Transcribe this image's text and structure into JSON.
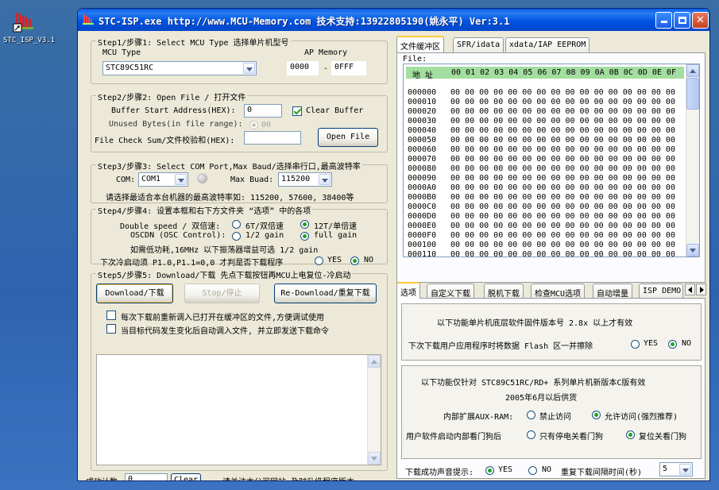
{
  "desktop": {
    "icon_label": "STC_ISP_V3.1"
  },
  "window": {
    "title": "STC-ISP.exe http://www.MCU-Memory.com 技术支持:13922805190(姚永平) Ver:3.1"
  },
  "step1": {
    "legend": "Step1/步骤1: Select MCU Type  选择单片机型号",
    "mcu_type_label": "MCU Type",
    "mcu_type_value": "STC89C51RC",
    "ap_memory_label": "AP Memory",
    "ap_start": "0000",
    "ap_dash": "-",
    "ap_end": "0FFF"
  },
  "step2": {
    "legend": "Step2/步骤2: Open File / 打开文件",
    "buffer_label": "Buffer Start Address(HEX):",
    "buffer_value": "0",
    "clear_buffer_label": "Clear Buffer",
    "unused_label": "Unused Bytes(in file range):",
    "unused_option": "00",
    "checksum_label": "File Check Sum/文件校验和(HEX):",
    "checksum_value": "",
    "open_file_label": "Open File"
  },
  "step3": {
    "legend": "Step3/步骤3: Select COM Port,Max Baud/选择串行口,最高波特率",
    "com_label": "COM:",
    "com_value": "COM1",
    "max_baud_label": "Max Buad:",
    "max_baud_value": "115200",
    "hint": "请选择最适合本台机器的最高波特率如: 115200, 57600, 38400等"
  },
  "step4": {
    "legend": "Step4/步骤4: 设置本框和右下方文件夹 “选项” 中的各项",
    "double_speed_label": "Double speed / 双倍速:",
    "opt_6t": "6T/双倍速",
    "opt_12t": "12T/单倍速",
    "oscdn_label": "OSCDN (OSC Control):",
    "opt_half_gain": "1/2 gain",
    "opt_full_gain": "full gain",
    "gain_hint": "如需低功耗,16MHz 以下振荡器增益可选 1/2 gain",
    "p10_label": "下次冷启动须 P1.0,P1.1=0,0 才判是否下载程序",
    "opt_yes": "YES",
    "opt_no": "NO"
  },
  "step5": {
    "legend": "Step5/步骤5: Download/下载  先点下载按钮再MCU上电复位-冷启动",
    "download_label": "Download/下载",
    "stop_label": "Stop/停止",
    "redownload_label": "Re-Download/重复下载",
    "reload_label": "每次下载前重新调入已打开在缓冲区的文件,方便调试使用",
    "auto_label": "当目标代码发生变化后自动调入文件, 并立即发送下载命令"
  },
  "bottom": {
    "success_count_label": "成功计数",
    "success_count_value": "0",
    "clear_label": "Clear",
    "notice": "请关注本公司网站,及时升级程序版本"
  },
  "buffer_tabs": [
    "文件缓冲区",
    "SFR/idata",
    "xdata/IAP EEPROM"
  ],
  "hex": {
    "file_label": "File:",
    "addr_header": "地 址",
    "columns": "00 01 02 03 04 05 06 07 08 09 0A 0B 0C 0D 0E 0F",
    "addresses": [
      "000000",
      "000010",
      "000020",
      "000030",
      "000040",
      "000050",
      "000060",
      "000070",
      "000080",
      "000090",
      "0000A0",
      "0000B0",
      "0000C0",
      "0000D0",
      "0000E0",
      "0000F0",
      "000100",
      "000110"
    ],
    "row_bytes": "00 00 00 00 00 00 00 00 00 00 00 00 00 00 00 00"
  },
  "option_tabs": [
    "选项",
    "自定义下载",
    "脱机下载",
    "检查MCU选项",
    "自动增量",
    "ISP DEMO"
  ],
  "options": {
    "firmware_note": "以下功能单片机底层软件固件版本号 2.8x 以上才有效",
    "flash_erase_label": "下次下载用户应用程序时将数据 Flash 区一并擦除",
    "opt_yes": "YES",
    "opt_no": "NO",
    "rd_note": "以下功能仅针对 STC89C51RC/RD+ 系列单片机新版本C版有效",
    "rd_date": "2005年6月以后供货",
    "aux_ram_label": "内部扩展AUX-RAM:",
    "aux_forbid": "禁止访问",
    "aux_allow": "允许访问(强烈推荐)",
    "watchdog_label": "用户软件启动内部看门狗后",
    "wd_power_only": "只有停电关看门狗",
    "wd_reset": "复位关看门狗",
    "sound_label": "下载成功声音提示:",
    "sound_yes": "YES",
    "sound_no": "NO",
    "interval_label": "重复下载间隔时间(秒)",
    "interval_value": "5"
  }
}
